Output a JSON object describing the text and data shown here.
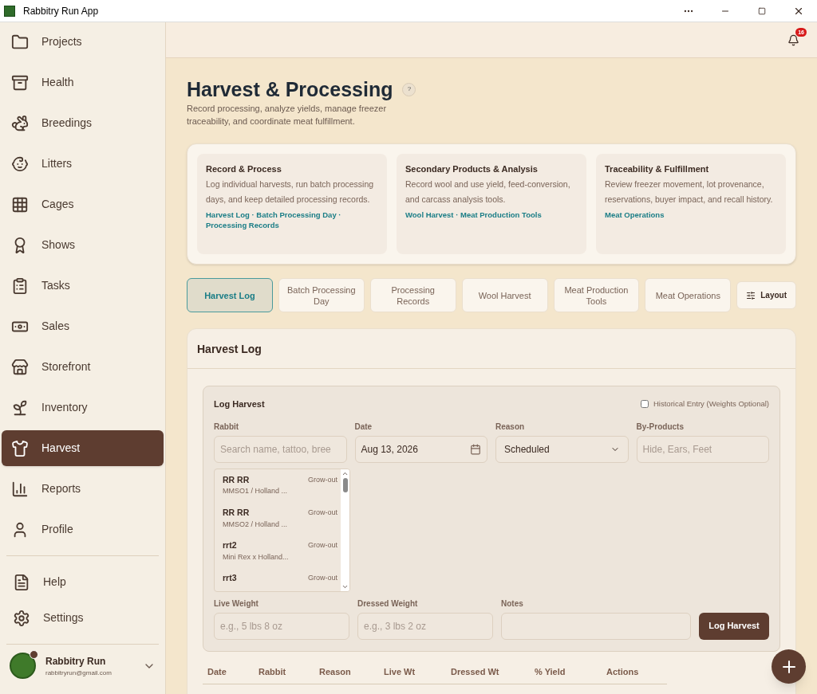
{
  "window": {
    "title": "Rabbitry Run App"
  },
  "sidebar": {
    "items": [
      {
        "label": "Projects",
        "selected": false
      },
      {
        "label": "Health",
        "selected": false
      },
      {
        "label": "Breedings",
        "selected": false
      },
      {
        "label": "Litters",
        "selected": false
      },
      {
        "label": "Cages",
        "selected": false
      },
      {
        "label": "Shows",
        "selected": false
      },
      {
        "label": "Tasks",
        "selected": false
      },
      {
        "label": "Sales",
        "selected": false
      },
      {
        "label": "Storefront",
        "selected": false
      },
      {
        "label": "Inventory",
        "selected": false
      },
      {
        "label": "Harvest",
        "selected": true
      },
      {
        "label": "Reports",
        "selected": false
      },
      {
        "label": "Profile",
        "selected": false
      }
    ],
    "footer_items": [
      {
        "label": "Help"
      },
      {
        "label": "Settings"
      }
    ],
    "account": {
      "name": "Rabbitry Run",
      "email": "rabbitryrun@gmail.com"
    }
  },
  "header": {
    "notification_count": "16"
  },
  "page": {
    "title": "Harvest & Processing",
    "help": "?",
    "subtitle": "Record processing, analyze yields, manage freezer traceability, and coordinate meat fulfillment."
  },
  "overview": [
    {
      "title": "Record & Process",
      "text": "Log individual harvests, run batch processing days, and keep detailed processing records.",
      "links": "Harvest Log · Batch Processing Day · Processing Records"
    },
    {
      "title": "Secondary Products & Analysis",
      "text": "Record wool and use yield, feed-conversion, and carcass analysis tools.",
      "links": "Wool Harvest · Meat Production Tools"
    },
    {
      "title": "Traceability & Fulfillment",
      "text": "Review freezer movement, lot provenance, reservations, buyer impact, and recall history.",
      "links": "Meat Operations"
    }
  ],
  "tabs": [
    {
      "label": "Harvest Log",
      "selected": true
    },
    {
      "label": "Batch Processing Day",
      "selected": false
    },
    {
      "label": "Processing Records",
      "selected": false
    },
    {
      "label": "Wool Harvest",
      "selected": false
    },
    {
      "label": "Meat Production Tools",
      "selected": false
    },
    {
      "label": "Meat Operations",
      "selected": false
    }
  ],
  "layout_button": "Layout",
  "section": {
    "title": "Harvest Log"
  },
  "form": {
    "title": "Log Harvest",
    "historical_entry": {
      "label": "Historical Entry (Weights Optional)",
      "checked": false
    },
    "rabbit": {
      "label": "Rabbit",
      "placeholder": "Search name, tattoo, bree"
    },
    "date": {
      "label": "Date",
      "value": "Aug 13, 2026"
    },
    "reason": {
      "label": "Reason",
      "value": "Scheduled"
    },
    "by_products": {
      "label": "By-Products",
      "placeholder": "Hide, Ears, Feet"
    },
    "rabbits": [
      {
        "name": "RR RR",
        "detail": "MMSO1 / Holland ...",
        "status": "Grow-out"
      },
      {
        "name": "RR RR",
        "detail": "MMSO2 / Holland ...",
        "status": "Grow-out"
      },
      {
        "name": "rrt2",
        "detail": "Mini Rex x Holland...",
        "status": "Grow-out"
      },
      {
        "name": "rrt3",
        "status": "Grow-out"
      }
    ],
    "live_weight": {
      "label": "Live Weight",
      "placeholder": "e.g., 5 lbs 8 oz"
    },
    "dressed_weight": {
      "label": "Dressed Weight",
      "placeholder": "e.g., 3 lbs 2 oz"
    },
    "notes": {
      "label": "Notes"
    },
    "submit": "Log Harvest"
  },
  "table": {
    "columns": [
      "Date",
      "Rabbit",
      "Reason",
      "Live Wt",
      "Dressed Wt",
      "% Yield",
      "Actions"
    ]
  }
}
